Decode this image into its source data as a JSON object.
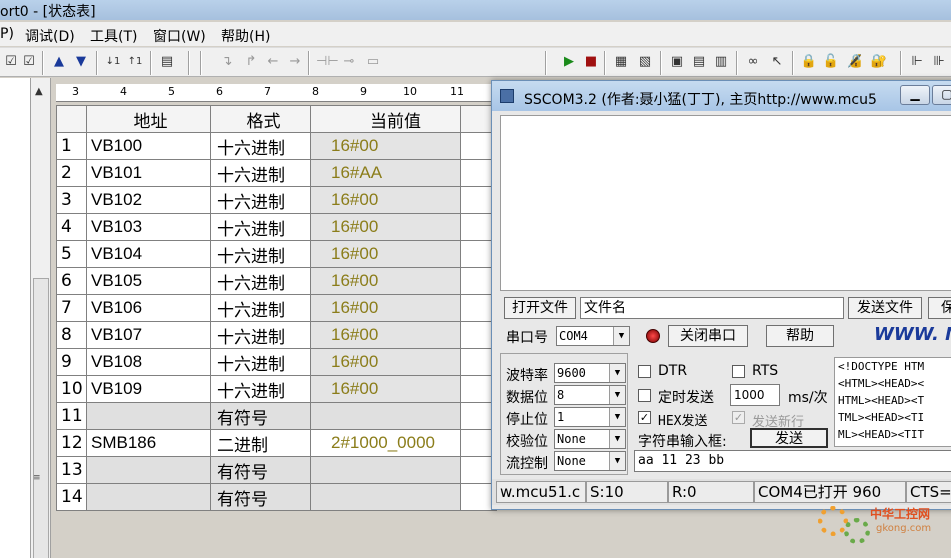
{
  "window": {
    "title": "ort0 - [状态表]"
  },
  "menu": [
    "P)",
    "调试(D)",
    "工具(T)",
    "窗口(W)",
    "帮助(H)"
  ],
  "ruler": [
    "3",
    "4",
    "5",
    "6",
    "7",
    "8",
    "9",
    "10",
    "11"
  ],
  "table": {
    "headers": [
      "",
      "地址",
      "格式",
      "当前值"
    ],
    "rows": [
      {
        "num": "1",
        "address": "VB100",
        "format": "十六进制",
        "value": "16#00"
      },
      {
        "num": "2",
        "address": "VB101",
        "format": "十六进制",
        "value": "16#AA"
      },
      {
        "num": "3",
        "address": "VB102",
        "format": "十六进制",
        "value": "16#00"
      },
      {
        "num": "4",
        "address": "VB103",
        "format": "十六进制",
        "value": "16#00"
      },
      {
        "num": "5",
        "address": "VB104",
        "format": "十六进制",
        "value": "16#00"
      },
      {
        "num": "6",
        "address": "VB105",
        "format": "十六进制",
        "value": "16#00"
      },
      {
        "num": "7",
        "address": "VB106",
        "format": "十六进制",
        "value": "16#00"
      },
      {
        "num": "8",
        "address": "VB107",
        "format": "十六进制",
        "value": "16#00"
      },
      {
        "num": "9",
        "address": "VB108",
        "format": "十六进制",
        "value": "16#00"
      },
      {
        "num": "10",
        "address": "VB109",
        "format": "十六进制",
        "value": "16#00"
      },
      {
        "num": "11",
        "address": "",
        "format": "有符号",
        "value": ""
      },
      {
        "num": "12",
        "address": "SMB186",
        "format": "二进制",
        "value": "2#1000_0000"
      },
      {
        "num": "13",
        "address": "",
        "format": "有符号",
        "value": ""
      },
      {
        "num": "14",
        "address": "",
        "format": "有符号",
        "value": ""
      }
    ]
  },
  "sscom": {
    "title": "SSCOM3.2 (作者:聂小猛(丁丁), 主页http://www.mcu5",
    "open_file": "打开文件",
    "file_name": "文件名",
    "send_file": "发送文件",
    "save": "保",
    "port_label": "串口号",
    "port_value": "COM4",
    "close_port": "关闭串口",
    "help": "帮助",
    "www": "WWW. M",
    "baud_label": "波特率",
    "baud_value": "9600",
    "databits_label": "数据位",
    "databits_value": "8",
    "stopbits_label": "停止位",
    "stopbits_value": "1",
    "parity_label": "校验位",
    "parity_value": "None",
    "flow_label": "流控制",
    "flow_value": "None",
    "dtr": "DTR",
    "rts": "RTS",
    "timed_send": "定时发送",
    "interval": "1000",
    "interval_unit": "ms/次",
    "hex_send": "HEX发送",
    "send_newline": "发送新行",
    "input_label": "字符串输入框:",
    "send": "发送",
    "input_value": "aa 11 23 bb",
    "preview": [
      "<!DOCTYPE HTM",
      "<HTML><HEAD><",
      "HTML><HEAD><T",
      "TML><HEAD><TI",
      "ML><HEAD><TIT"
    ],
    "status": {
      "site": "w.mcu51.c",
      "s": "S:10",
      "r": "R:0",
      "port": "COM4已打开 960",
      "cts": "CTS="
    }
  },
  "brand": {
    "name": "中华工控网",
    "url": "gkong.com"
  },
  "colors": {
    "value_text": "#8b7d1a",
    "accent_link": "#1a3a9a"
  }
}
